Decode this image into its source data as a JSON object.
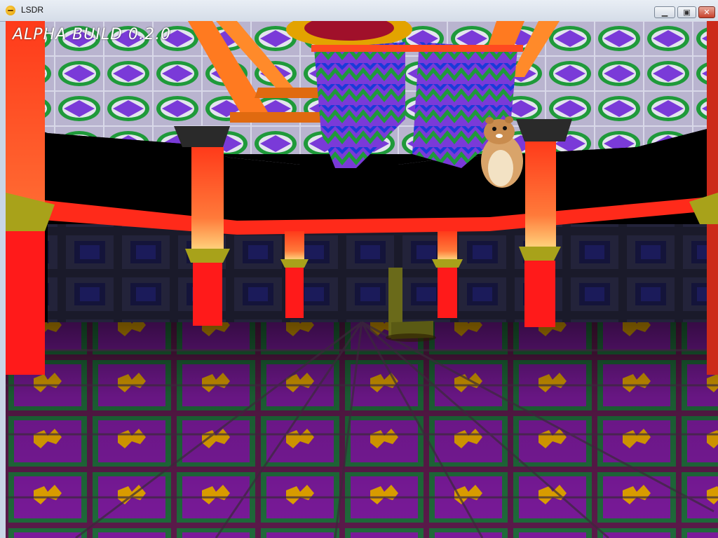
{
  "window": {
    "title": "LSDR",
    "icon": "app-face-icon",
    "buttons": {
      "minimize": "minimize-icon",
      "maximize": "maximize-icon",
      "close": "close-icon"
    }
  },
  "hud": {
    "build_label": "ALPHA BUILD 0.2.0"
  },
  "colors": {
    "pillar_red": "#ff2a1a",
    "pillar_cap": "#a8a21a",
    "ceiling_tile": "#7a3ad8",
    "ceiling_ring": "#1f9a3a",
    "floor_purple": "#7a1a9a",
    "floor_yellow": "#e3a300",
    "beam_orange": "#ff7a20"
  }
}
